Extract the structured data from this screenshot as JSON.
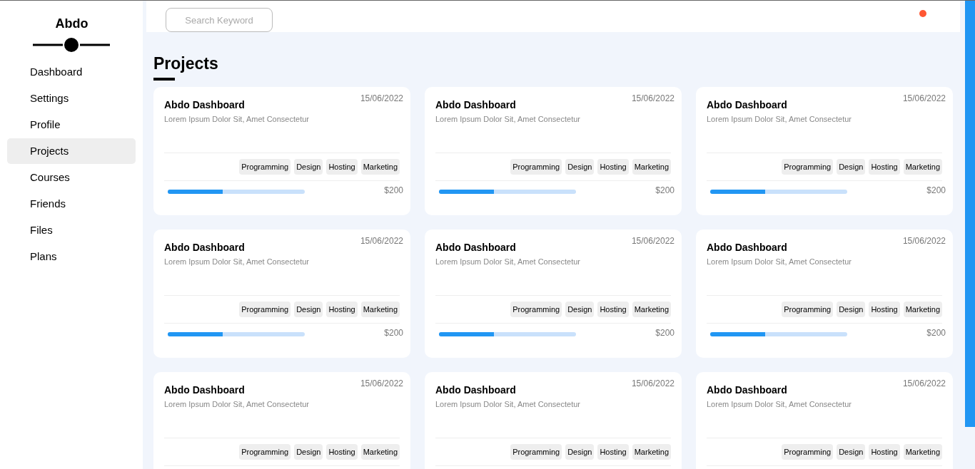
{
  "sidebar": {
    "brand": "Abdo",
    "items": [
      {
        "label": "Dashboard",
        "selected": false
      },
      {
        "label": "Settings",
        "selected": false
      },
      {
        "label": "Profile",
        "selected": false
      },
      {
        "label": "Projects",
        "selected": true
      },
      {
        "label": "Courses",
        "selected": false
      },
      {
        "label": "Friends",
        "selected": false
      },
      {
        "label": "Files",
        "selected": false
      },
      {
        "label": "Plans",
        "selected": false
      }
    ]
  },
  "header": {
    "search": {
      "placeholder": "Search Keyword"
    }
  },
  "page_title": "Projects",
  "projects": [
    {
      "title": "Abdo Dashboard",
      "description": "Lorem Ipsum Dolor Sit, Amet Consectetur",
      "date": "15/06/2022",
      "tags": [
        "Programming",
        "Design",
        "Hosting",
        "Marketing"
      ],
      "level": 0.4,
      "price": "$200"
    },
    {
      "title": "Abdo Dashboard",
      "description": "Lorem Ipsum Dolor Sit, Amet Consectetur",
      "date": "15/06/2022",
      "tags": [
        "Programming",
        "Design",
        "Hosting",
        "Marketing"
      ],
      "level": 0.4,
      "price": "$200"
    },
    {
      "title": "Abdo Dashboard",
      "description": "Lorem Ipsum Dolor Sit, Amet Consectetur",
      "date": "15/06/2022",
      "tags": [
        "Programming",
        "Design",
        "Hosting",
        "Marketing"
      ],
      "level": 0.4,
      "price": "$200"
    },
    {
      "title": "Abdo Dashboard",
      "description": "Lorem Ipsum Dolor Sit, Amet Consectetur",
      "date": "15/06/2022",
      "tags": [
        "Programming",
        "Design",
        "Hosting",
        "Marketing"
      ],
      "level": 0.4,
      "price": "$200"
    },
    {
      "title": "Abdo Dashboard",
      "description": "Lorem Ipsum Dolor Sit, Amet Consectetur",
      "date": "15/06/2022",
      "tags": [
        "Programming",
        "Design",
        "Hosting",
        "Marketing"
      ],
      "level": 0.4,
      "price": "$200"
    },
    {
      "title": "Abdo Dashboard",
      "description": "Lorem Ipsum Dolor Sit, Amet Consectetur",
      "date": "15/06/2022",
      "tags": [
        "Programming",
        "Design",
        "Hosting",
        "Marketing"
      ],
      "level": 0.4,
      "price": "$200"
    },
    {
      "title": "Abdo Dashboard",
      "description": "Lorem Ipsum Dolor Sit, Amet Consectetur",
      "date": "15/06/2022",
      "tags": [
        "Programming",
        "Design",
        "Hosting",
        "Marketing"
      ]
    },
    {
      "title": "Abdo Dashboard",
      "description": "Lorem Ipsum Dolor Sit, Amet Consectetur",
      "date": "15/06/2022",
      "tags": [
        "Programming",
        "Design",
        "Hosting",
        "Marketing"
      ]
    },
    {
      "title": "Abdo Dashboard",
      "description": "Lorem Ipsum Dolor Sit, Amet Consectetur",
      "date": "15/06/2022",
      "tags": [
        "Programming",
        "Design",
        "Hosting",
        "Marketing"
      ]
    }
  ]
}
